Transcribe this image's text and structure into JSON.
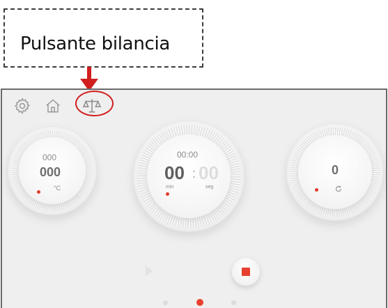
{
  "callout": {
    "label": "Pulsante bilancia"
  },
  "toolbar": {
    "settings_icon": "gear-icon",
    "home_icon": "home-icon",
    "scale_icon": "scale-icon"
  },
  "temperature_dial": {
    "target": "000",
    "value": "000",
    "unit": "°C"
  },
  "timer_dial": {
    "set_time": "00:00",
    "minutes": "00",
    "separator": ":",
    "seconds": "00",
    "min_label": "min",
    "sec_label": "seg"
  },
  "speed_dial": {
    "value": "0"
  },
  "colors": {
    "accent": "#e8402f",
    "callout_arrow": "#d11f1f"
  }
}
